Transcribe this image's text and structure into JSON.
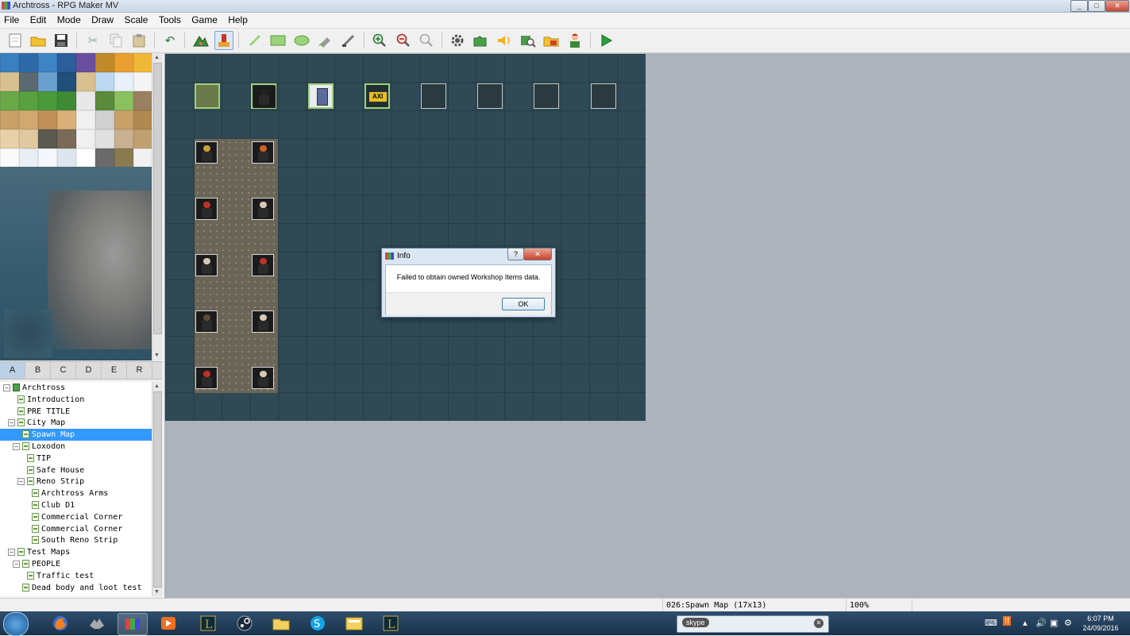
{
  "window": {
    "title": "Archtross - RPG Maker MV",
    "controls": [
      "_",
      "□",
      "✕"
    ]
  },
  "menu": [
    "File",
    "Edit",
    "Mode",
    "Draw",
    "Scale",
    "Tools",
    "Game",
    "Help"
  ],
  "toolbar": {
    "icons": [
      "new-project-icon",
      "open-project-icon",
      "save-icon",
      "cut-icon",
      "copy-icon",
      "paste-icon",
      "undo-icon",
      "map-mode-icon",
      "event-mode-icon",
      "pencil-icon",
      "rectangle-icon",
      "ellipse-icon",
      "fill-icon",
      "shadow-pen-icon",
      "zoom-in-icon",
      "zoom-out-icon",
      "actual-size-icon",
      "database-icon",
      "plugin-manager-icon",
      "sound-test-icon",
      "event-searcher-icon",
      "resource-manager-icon",
      "character-generator-icon",
      "playtest-icon"
    ],
    "active": "event-mode-icon"
  },
  "tileset_tabs": [
    "A",
    "B",
    "C",
    "D",
    "E",
    "R"
  ],
  "active_tab": "A",
  "map_tree": [
    {
      "label": "Archtross",
      "depth": 0,
      "expander": "⊟",
      "project": true
    },
    {
      "label": "Introduction",
      "depth": 1
    },
    {
      "label": "PRE TITLE",
      "depth": 1
    },
    {
      "label": "City Map",
      "depth": 1,
      "expander": "⊟"
    },
    {
      "label": "Spawn Map",
      "depth": 2,
      "selected": true
    },
    {
      "label": "Loxodon",
      "depth": 2,
      "expander": "⊟"
    },
    {
      "label": "TIP",
      "depth": 3
    },
    {
      "label": "Safe House",
      "depth": 3
    },
    {
      "label": "Reno Strip",
      "depth": 3,
      "expander": "⊟"
    },
    {
      "label": "Archtross Arms",
      "depth": 4
    },
    {
      "label": "Club D1",
      "depth": 4
    },
    {
      "label": "Commercial Corner",
      "depth": 4
    },
    {
      "label": "Commercial Corner",
      "depth": 4
    },
    {
      "label": "South Reno Strip",
      "depth": 4
    },
    {
      "label": "Test Maps",
      "depth": 1,
      "expander": "⊟"
    },
    {
      "label": "PEOPLE",
      "depth": 2,
      "expander": "⊟"
    },
    {
      "label": "Traffic test",
      "depth": 3
    },
    {
      "label": "Dead body and loot test",
      "depth": 2
    }
  ],
  "map": {
    "slot_labels": [
      "",
      "",
      "",
      "AXI",
      "",
      "",
      "",
      ""
    ],
    "head_colors_left": [
      "#c9a13a",
      "#c0302a",
      "#d8c8b8",
      "#5a4a3a",
      "#c0302a"
    ],
    "head_colors_right": [
      "#d06020",
      "#d8c8b8",
      "#c0302a",
      "#d8c8b8",
      "#d8c8b8"
    ]
  },
  "dialog": {
    "title": "Info",
    "message": "Failed to obtain owned Workshop Items data.",
    "ok": "OK",
    "help": "?",
    "close": "✕"
  },
  "status": {
    "map": "026:Spawn Map (17x13)",
    "zoom": "100%"
  },
  "taskbar": {
    "apps": [
      "firefox-icon",
      "wolf-app-icon",
      "rpg-maker-icon",
      "media-player-icon",
      "league-icon",
      "steam-icon",
      "folder-icon",
      "skype-icon",
      "file-manager-icon",
      "league-client-icon"
    ],
    "active": "rpg-maker-icon",
    "skype_label": "skype",
    "clock_time": "6:07 PM",
    "clock_date": "24/09/2016"
  }
}
